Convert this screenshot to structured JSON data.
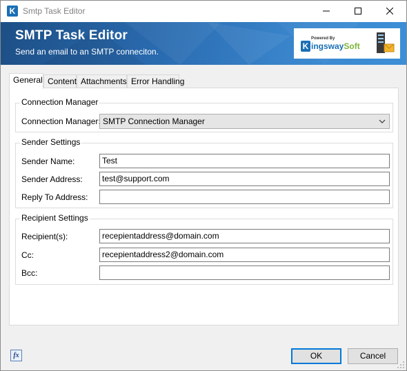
{
  "window": {
    "title": "Smtp Task Editor",
    "app_icon_letter": "K"
  },
  "banner": {
    "title": "SMTP Task Editor",
    "subtitle": "Send an email to an SMTP conneciton.",
    "logo_powered": "Powered By",
    "logo_brand_k": "K",
    "logo_brand_main": "ingsway",
    "logo_brand_soft": "Soft"
  },
  "tabs": [
    {
      "label": "General",
      "active": true
    },
    {
      "label": "Content",
      "active": false
    },
    {
      "label": "Attachments",
      "active": false
    },
    {
      "label": "Error Handling",
      "active": false
    }
  ],
  "connection_group": {
    "legend": "Connection Manager",
    "label": "Connection Manager:",
    "selected": "SMTP Connection Manager"
  },
  "sender_group": {
    "legend": "Sender Settings",
    "name_label": "Sender Name:",
    "name_value": "Test",
    "address_label": "Sender Address:",
    "address_value": "test@support.com",
    "reply_label": "Reply To Address:",
    "reply_value": ""
  },
  "recipient_group": {
    "legend": "Recipient Settings",
    "to_label": "Recipient(s):",
    "to_value": "recepientaddress@domain.com",
    "cc_label": "Cc:",
    "cc_value": "recepientaddress2@domain.com",
    "bcc_label": "Bcc:",
    "bcc_value": ""
  },
  "footer": {
    "fx_label": "fx",
    "ok_label": "OK",
    "cancel_label": "Cancel"
  },
  "colors": {
    "banner_start": "#1d4f86",
    "banner_end": "#3d8fd6",
    "brand_blue": "#1a6fb5",
    "brand_green": "#7bb536",
    "focus_border": "#0078d7"
  }
}
